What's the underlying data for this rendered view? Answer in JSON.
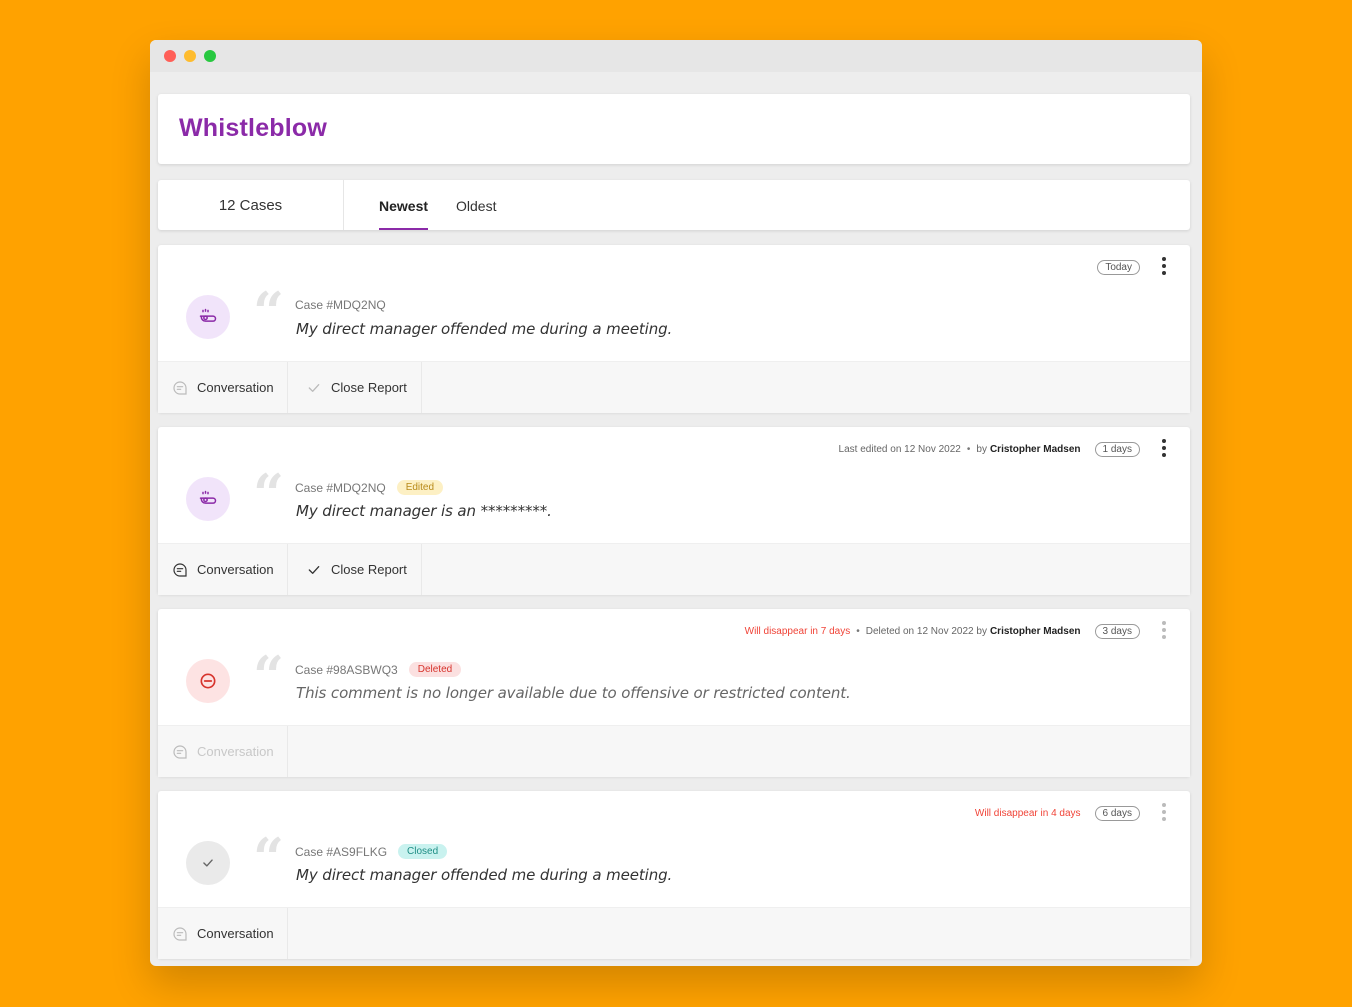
{
  "app": {
    "title": "Whistleblow"
  },
  "tabs": {
    "count": "12 Cases",
    "newest": "Newest",
    "oldest": "Oldest"
  },
  "cases": [
    {
      "id": "Case #MDQ2NQ",
      "text": "My direct manager offended me during a meeting.",
      "age": "Today",
      "icon": "whistle-icon",
      "actions": {
        "conversation": "Conversation",
        "close": "Close Report"
      }
    },
    {
      "id": "Case #MDQ2NQ",
      "badge": "Edited",
      "text": "My direct manager is an *********.",
      "meta": {
        "edited": "Last edited on 12 Nov 2022",
        "by": "by",
        "author": "Cristopher Madsen"
      },
      "age": "1 days",
      "icon": "whistle-icon",
      "actions": {
        "conversation": "Conversation",
        "close": "Close Report"
      }
    },
    {
      "id": "Case #98ASBWQ3",
      "badge": "Deleted",
      "text": "This comment is no longer available due to offensive or restricted content.",
      "meta": {
        "warning": "Will disappear in 7 days",
        "deleted": "Deleted on 12 Nov 2022 by",
        "author": "Cristopher Madsen"
      },
      "age": "3 days",
      "icon": "minus-circle-icon",
      "actions": {
        "conversation": "Conversation"
      }
    },
    {
      "id": "Case #AS9FLKG",
      "badge": "Closed",
      "text": "My direct manager offended me during a meeting.",
      "meta": {
        "warning": "Will disappear in 4 days"
      },
      "age": "6 days",
      "icon": "check-icon",
      "actions": {
        "conversation": "Conversation"
      }
    }
  ],
  "colors": {
    "background": "#FFA200",
    "brand": "#8B2AA8",
    "warning": "#F04438"
  }
}
